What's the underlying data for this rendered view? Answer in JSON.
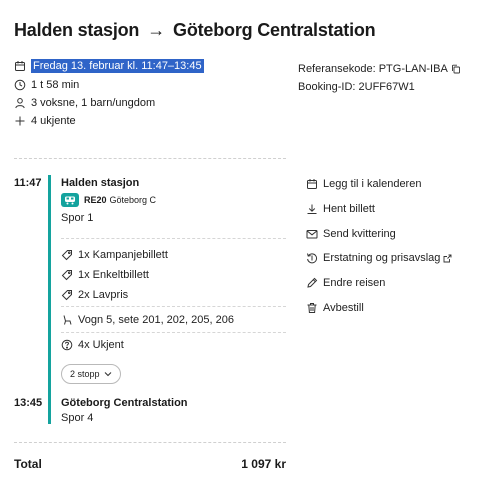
{
  "header": {
    "from": "Halden stasjon",
    "arrow": "→",
    "to": "Göteborg Centralstation"
  },
  "summary": {
    "date": "Fredag 13. februar kl. 11:47–13:45",
    "duration": "1 t 58 min",
    "travelers": "3 voksne, 1 barn/ungdom",
    "extra": "4 ukjente"
  },
  "reference": {
    "ref_code": "Referansekode: PTG-LAN-IBA",
    "booking_id": "Booking-ID: 2UFF67W1"
  },
  "journey": {
    "departure_time": "11:47",
    "departure_station": "Halden stasjon",
    "train_number": "RE20",
    "train_destination": "Göteborg C",
    "departure_track": "Spor 1",
    "tickets": [
      "1x Kampanjebillett",
      "1x Enkeltbillett",
      "2x Lavpris"
    ],
    "seats": "Vogn 5, sete 201, 202, 205, 206",
    "unknown": "4x Ukjent",
    "stops_button": "2 stopp",
    "arrival_time": "13:45",
    "arrival_station": "Göteborg Centralstation",
    "arrival_track": "Spor 4"
  },
  "actions": [
    {
      "label": "Legg til i kalenderen",
      "icon": "calendar-icon"
    },
    {
      "label": "Hent billett",
      "icon": "download-icon"
    },
    {
      "label": "Send kvittering",
      "icon": "mail-icon"
    },
    {
      "label": "Erstatning og prisavslag",
      "icon": "refund-icon"
    },
    {
      "label": "Endre reisen",
      "icon": "pencil-icon"
    },
    {
      "label": "Avbestill",
      "icon": "trash-icon"
    }
  ],
  "total": {
    "label": "Total",
    "value": "1 097 kr"
  },
  "colors": {
    "accent": "#14a39e",
    "selection": "#2f64c8"
  }
}
